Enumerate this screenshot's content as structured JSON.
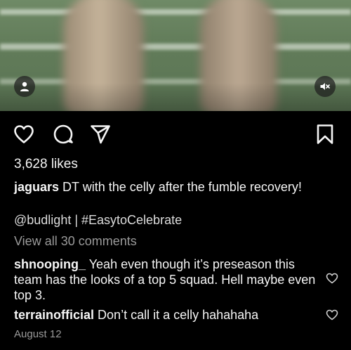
{
  "post": {
    "likes_text": "3,628 likes",
    "author": "jaguars",
    "caption_text": "DT with the celly after the fumble recovery!",
    "tags_text": "@budlight | #EasytoCelebrate",
    "view_all_text": "View all 30 comments",
    "date_text": "August 12"
  },
  "comments": [
    {
      "user": "shnooping_",
      "text": "Yeah even though it’s preseason this team has the looks of a top 5 squad. Hell maybe even top 3."
    },
    {
      "user": "terrainofficial",
      "text": "Don’t call it a celly hahahaha"
    }
  ],
  "icons": {
    "user_tag": "person-icon",
    "mute": "speaker-muted-icon",
    "like": "heart-icon",
    "comment": "speech-bubble-icon",
    "share": "paper-plane-icon",
    "save": "bookmark-icon",
    "comment_like": "small-heart-icon"
  },
  "colors": {
    "background": "#000000",
    "text": "#f5f5f5",
    "muted": "#9a9a9a"
  }
}
